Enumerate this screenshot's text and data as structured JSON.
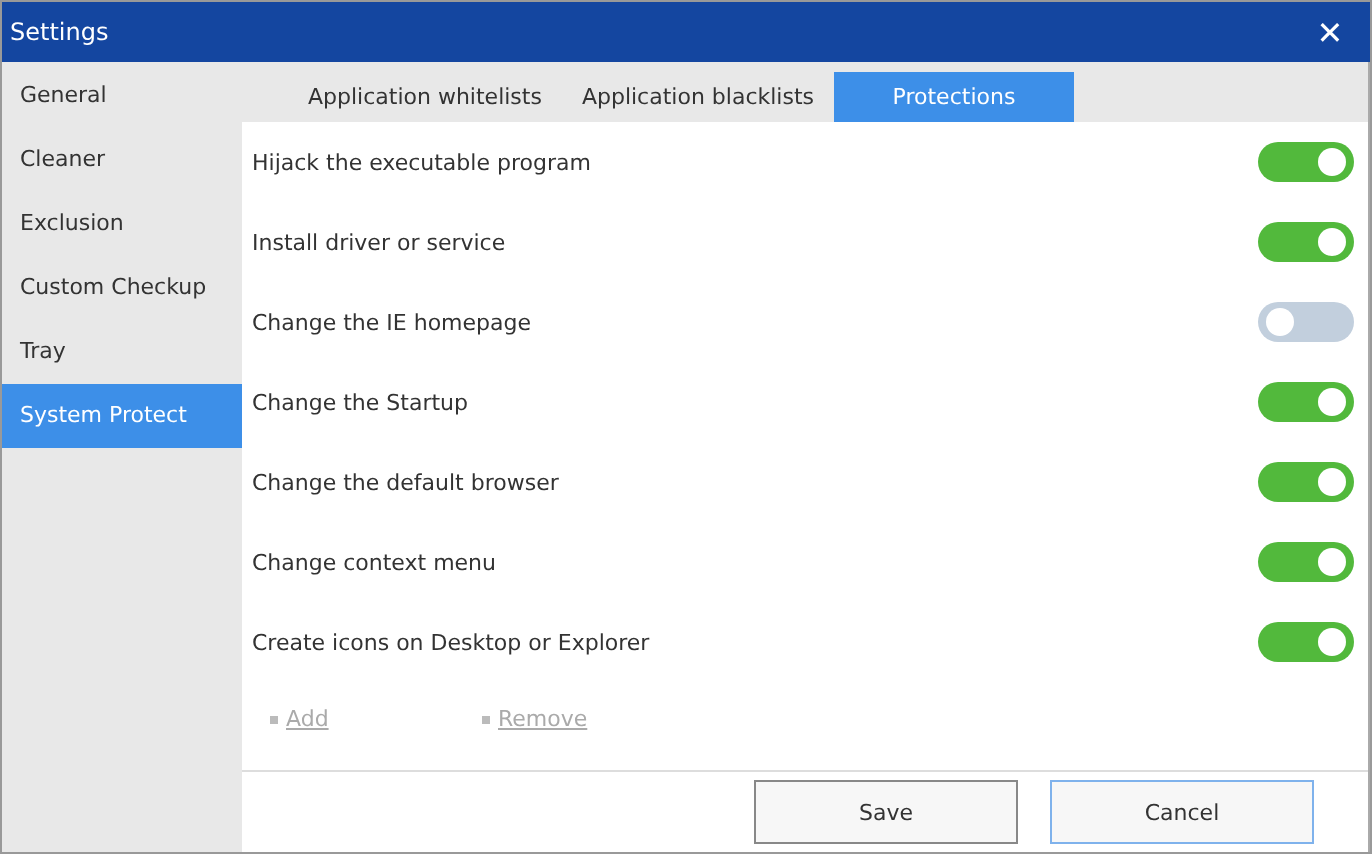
{
  "window": {
    "title": "Settings",
    "close": "✕"
  },
  "sidebar": {
    "items": [
      {
        "label": "General",
        "selected": false
      },
      {
        "label": "Cleaner",
        "selected": false
      },
      {
        "label": "Exclusion",
        "selected": false
      },
      {
        "label": "Custom Checkup",
        "selected": false
      },
      {
        "label": "Tray",
        "selected": false
      },
      {
        "label": "System Protect",
        "selected": true
      }
    ]
  },
  "tabs": [
    {
      "label": "Application whitelists",
      "selected": false
    },
    {
      "label": "Application blacklists",
      "selected": false
    },
    {
      "label": "Protections",
      "selected": true
    }
  ],
  "protections": [
    {
      "label": "Hijack the executable program",
      "on": true
    },
    {
      "label": "Install driver or service",
      "on": true
    },
    {
      "label": "Change the IE homepage",
      "on": false
    },
    {
      "label": "Change the Startup",
      "on": true
    },
    {
      "label": "Change the default browser",
      "on": true
    },
    {
      "label": "Change context menu",
      "on": true
    },
    {
      "label": "Create icons on Desktop or Explorer",
      "on": true
    }
  ],
  "links": [
    {
      "label": "Add",
      "disabled": true
    },
    {
      "label": "Remove",
      "disabled": true
    }
  ],
  "buttons": [
    {
      "label": "Save",
      "selected": false
    },
    {
      "label": "Cancel",
      "selected": true
    }
  ]
}
